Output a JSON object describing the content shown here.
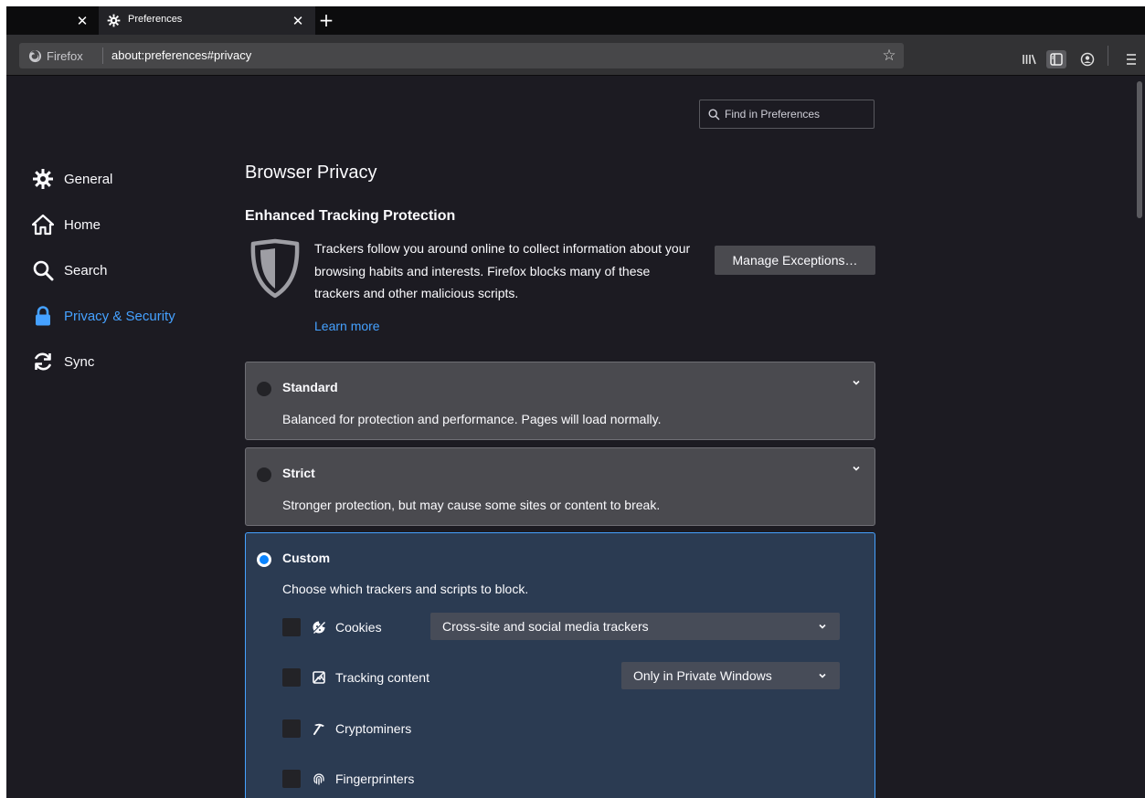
{
  "browser": {
    "prev_tab_close": "✕",
    "active_tab": {
      "label": "Preferences",
      "close": "✕"
    },
    "new_tab": "+",
    "identity_label": "Firefox",
    "url": "about:preferences#privacy",
    "bookmark_star": "☆"
  },
  "search": {
    "placeholder": "Find in Preferences"
  },
  "sidebar": {
    "items": [
      {
        "label": "General",
        "icon": "gear-icon"
      },
      {
        "label": "Home",
        "icon": "home-icon"
      },
      {
        "label": "Search",
        "icon": "search-icon"
      },
      {
        "label": "Privacy & Security",
        "icon": "lock-icon",
        "selected": true
      },
      {
        "label": "Sync",
        "icon": "sync-icon"
      }
    ]
  },
  "main": {
    "page_title": "Browser Privacy",
    "section_title": "Enhanced Tracking Protection",
    "description": "Trackers follow you around online to collect information about your browsing habits and interests. Firefox blocks many of these trackers and other malicious scripts.",
    "learn_more": "Learn more",
    "manage_exceptions": "Manage Exceptions…",
    "options": {
      "standard": {
        "title": "Standard",
        "desc": "Balanced for protection and performance. Pages will load normally.",
        "checked": false
      },
      "strict": {
        "title": "Strict",
        "desc": "Stronger protection, but may cause some sites or content to break.",
        "checked": false
      },
      "custom": {
        "title": "Custom",
        "desc": "Choose which trackers and scripts to block.",
        "checked": true,
        "trackers": [
          {
            "label": "Cookies",
            "icon": "cookie-icon",
            "checked": false,
            "select": "Cross-site and social media trackers"
          },
          {
            "label": "Tracking content",
            "icon": "tracking-content-icon",
            "checked": false,
            "select": "Only in Private Windows"
          },
          {
            "label": "Cryptominers",
            "icon": "cryptominer-icon",
            "checked": false
          },
          {
            "label": "Fingerprinters",
            "icon": "fingerprint-icon",
            "checked": false
          }
        ]
      }
    }
  },
  "colors": {
    "accent": "#45a1ff",
    "background": "#1c1b22",
    "card": "#4a4a4f",
    "custom_card": "#2b3b52"
  }
}
